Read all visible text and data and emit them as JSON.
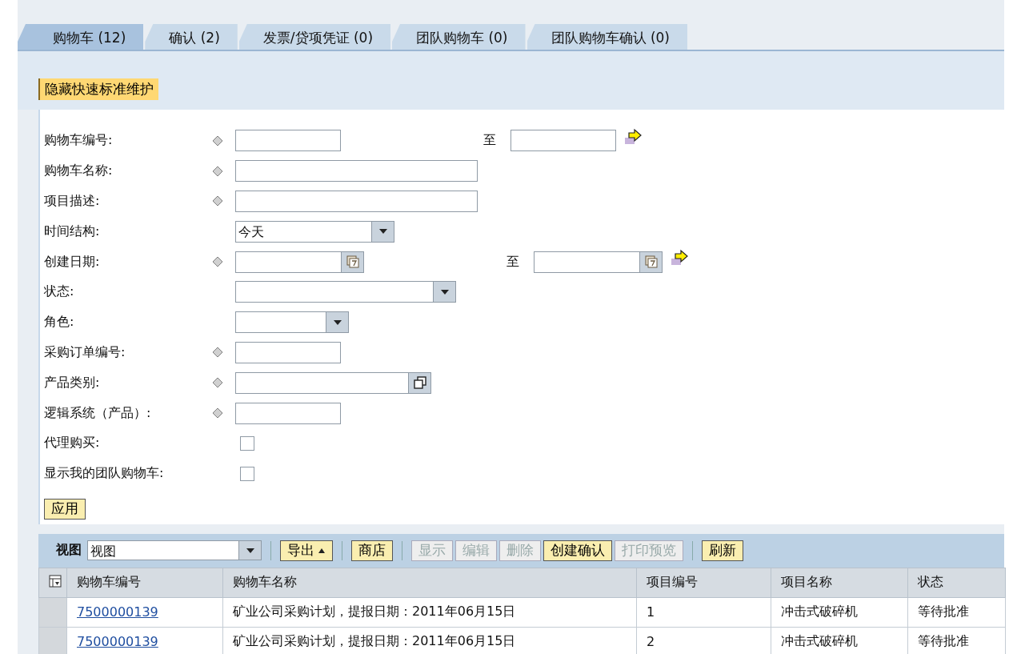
{
  "tabs": [
    {
      "label": "购物车 (12)",
      "selected": true
    },
    {
      "label": "确认 (2)",
      "selected": false
    },
    {
      "label": "发票/贷项凭证 (0)",
      "selected": false
    },
    {
      "label": "团队购物车 (0)",
      "selected": false
    },
    {
      "label": "团队购物车确认 (0)",
      "selected": false
    }
  ],
  "toggle_button": "隐藏快速标准维护",
  "form": {
    "fields": [
      {
        "label": "购物车编号:",
        "kind": "range",
        "marker": true,
        "to_label": "至"
      },
      {
        "label": "购物车名称:",
        "kind": "text",
        "marker": true
      },
      {
        "label": "项目描述:",
        "kind": "text",
        "marker": true
      },
      {
        "label": "时间结构:",
        "kind": "select-medium",
        "marker": false,
        "value": "今天"
      },
      {
        "label": "创建日期:",
        "kind": "date-range",
        "marker": true,
        "to_label": "至"
      },
      {
        "label": "状态:",
        "kind": "select-long",
        "marker": false
      },
      {
        "label": "角色:",
        "kind": "select-short",
        "marker": false
      },
      {
        "label": "采购订单编号:",
        "kind": "short-text",
        "marker": true
      },
      {
        "label": "产品类别:",
        "kind": "help",
        "marker": true
      },
      {
        "label": "逻辑系统（产品）:",
        "kind": "short-text",
        "marker": true
      },
      {
        "label": "代理购买:",
        "kind": "check",
        "marker": false,
        "checked": false
      },
      {
        "label": "显示我的团队购物车:",
        "kind": "check",
        "marker": false,
        "checked": false
      }
    ],
    "apply_button": "应用"
  },
  "toolbar": {
    "view_label": "视图",
    "view_value": "视图",
    "buttons": [
      {
        "label": "导出",
        "disabled": false,
        "menu": true,
        "separator_before": true
      },
      {
        "label": "商店",
        "disabled": false,
        "menu": false,
        "separator_before": true
      },
      {
        "label": "显示",
        "disabled": true,
        "menu": false,
        "separator_before": true
      },
      {
        "label": "编辑",
        "disabled": true,
        "menu": false,
        "separator_before": false
      },
      {
        "label": "删除",
        "disabled": true,
        "menu": false,
        "separator_before": false
      },
      {
        "label": "创建确认",
        "disabled": false,
        "menu": false,
        "separator_before": false
      },
      {
        "label": "打印预览",
        "disabled": true,
        "menu": false,
        "separator_before": false
      },
      {
        "label": "刷新",
        "disabled": false,
        "menu": false,
        "separator_before": true
      }
    ]
  },
  "table": {
    "columns": [
      "购物车编号",
      "购物车名称",
      "项目编号",
      "项目名称",
      "状态"
    ],
    "rows": [
      [
        "7500000139",
        "矿业公司采购计划，提报日期：2011年06月15日",
        "1",
        "冲击式破碎机",
        "等待批准"
      ],
      [
        "7500000139",
        "矿业公司采购计划，提报日期：2011年06月15日",
        "2",
        "冲击式破碎机",
        "等待批准"
      ]
    ]
  }
}
